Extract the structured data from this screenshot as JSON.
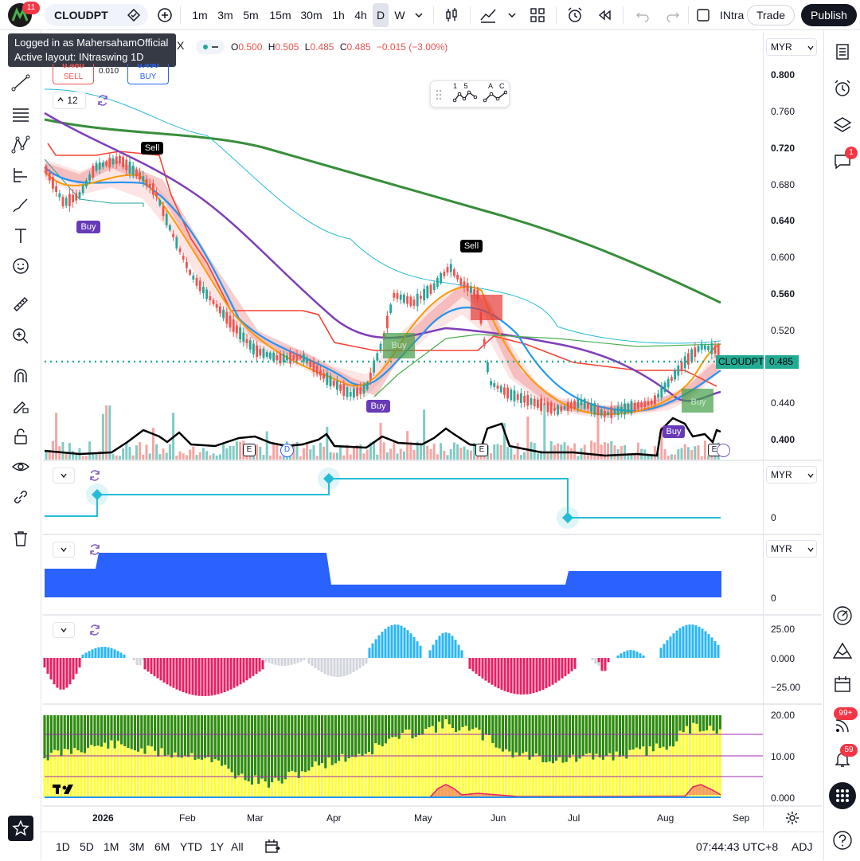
{
  "app": {
    "symbol": "CLOUDPT",
    "notification_count": "11",
    "timeframes": [
      "1m",
      "3m",
      "5m",
      "15m",
      "30m",
      "1h",
      "4h",
      "D",
      "W"
    ],
    "active_timeframe": "D",
    "layout_name": "INtra",
    "trade_label": "Trade",
    "publish_label": "Publish"
  },
  "tooltip": {
    "line1": "Logged in as MahersahamOfficial",
    "line2": "Active layout: INtraswing 1D"
  },
  "legend": {
    "exchange_suffix": "X",
    "open_label": "O",
    "open": "0.500",
    "high_label": "H",
    "high": "0.505",
    "low_label": "L",
    "low": "0.485",
    "close_label": "C",
    "close": "0.485",
    "change": "−0.015 (−3.00%)",
    "sell_price": "0.480",
    "sell_label": "SELL",
    "spread": "0.010",
    "buy_price": "0.490",
    "buy_label": "BUY",
    "indicator_count": "12"
  },
  "drawing_toolbar": {
    "label1": "1 5",
    "label2": "A C"
  },
  "price_scale": {
    "unit": "MYR",
    "labels": [
      "0.800",
      "0.760",
      "0.720",
      "0.680",
      "0.640",
      "0.600",
      "0.560",
      "0.520",
      "0.480",
      "0.440",
      "0.400"
    ],
    "bold_labels": [
      "0.720",
      "0.640",
      "0.560",
      "0.400"
    ],
    "current_symbol": "CLOUDPT",
    "current_price": "0.485"
  },
  "pane2": {
    "unit": "MYR",
    "label": "0"
  },
  "pane3": {
    "unit": "MYR",
    "label": "0"
  },
  "pane4": {
    "labels": [
      "25.00",
      "0.000",
      "−25.00"
    ]
  },
  "pane5": {
    "labels": [
      "20.00",
      "10.00",
      "0.000"
    ]
  },
  "signals": [
    "Sell",
    "Buy",
    "Sell",
    "Buy",
    "Buy",
    "Buy",
    "Buy"
  ],
  "events": [
    "E",
    "D",
    "E",
    "E"
  ],
  "time_axis": {
    "months": [
      "2026",
      "Feb",
      "Mar",
      "Apr",
      "May",
      "Jun",
      "Jul",
      "Aug",
      "Sep"
    ]
  },
  "bottom_bar": {
    "ranges": [
      "1D",
      "5D",
      "1M",
      "3M",
      "6M",
      "YTD",
      "1Y",
      "All"
    ],
    "clock": "07:44:43 UTC+8",
    "adj": "ADJ"
  },
  "right_badges": {
    "chat": "1",
    "ideas": "99+",
    "alerts": "59"
  },
  "colors": {
    "accent": "#2962ff",
    "up": "#26a69a",
    "down": "#ef5350",
    "signal_buy": "#673ab7",
    "price_line": "#22ab94",
    "ema_green": "#388e3c",
    "ema_purple": "#7e3fb8",
    "ema_blue": "#2196f3",
    "ema_orange": "#ff9800",
    "step_cyan": "#26bcd6",
    "histogram_up": "#29b6f6",
    "histogram_down": "#e91e63",
    "area_yellow": "#ffff33",
    "area_green": "#2e8b0e"
  }
}
